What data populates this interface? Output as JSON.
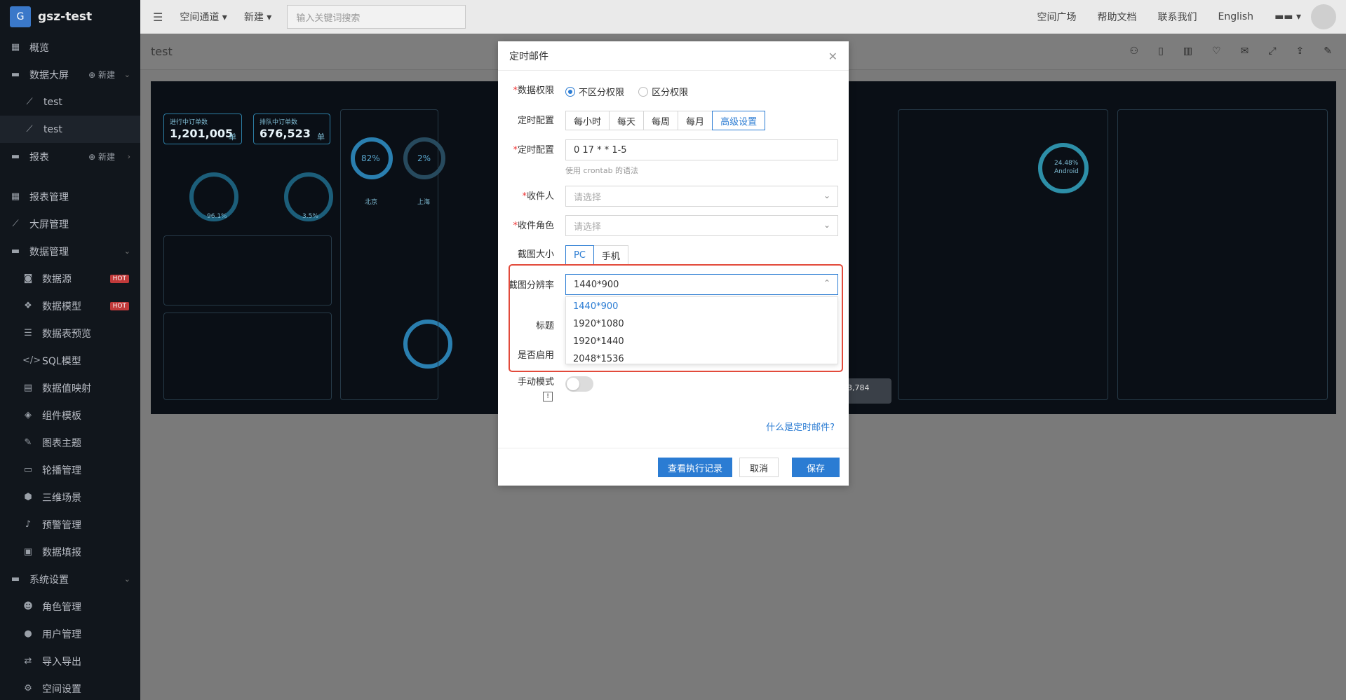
{
  "sidebar": {
    "brand_letter": "G",
    "brand_name": "gsz-test",
    "new_label": "新建",
    "items": [
      {
        "label": "概览"
      },
      {
        "label": "数据大屏"
      },
      {
        "label": "test"
      },
      {
        "label": "test"
      },
      {
        "label": "报表"
      },
      {
        "label": "报表管理"
      },
      {
        "label": "大屏管理"
      },
      {
        "label": "数据管理"
      },
      {
        "label": "数据源"
      },
      {
        "label": "数据模型"
      },
      {
        "label": "数据表预览"
      },
      {
        "label": "SQL模型"
      },
      {
        "label": "数据值映射"
      },
      {
        "label": "组件模板"
      },
      {
        "label": "图表主题"
      },
      {
        "label": "轮播管理"
      },
      {
        "label": "三维场景"
      },
      {
        "label": "预警管理"
      },
      {
        "label": "数据填报"
      },
      {
        "label": "系统设置"
      },
      {
        "label": "角色管理"
      },
      {
        "label": "用户管理"
      },
      {
        "label": "导入导出"
      },
      {
        "label": "空间设置"
      }
    ],
    "hot_label": "HOT"
  },
  "topbar": {
    "space_channel": "空间通道",
    "new": "新建",
    "search_placeholder": "输入关键词搜索",
    "plaza": "空间广场",
    "help": "帮助文档",
    "contact": "联系我们",
    "language": "English"
  },
  "subbar": {
    "title": "test"
  },
  "preview": {
    "card1_label": "进行中订单数",
    "card1_value": "1,201,005",
    "card1_unit": "单",
    "card2_label": "排队中订单数",
    "card2_value": "676,523",
    "card2_unit": "单",
    "gauge1_pct": "82%",
    "gauge2_pct": "2%",
    "city1": "北京",
    "city2": "上海",
    "pct_android": "24.48%",
    "android": "Android",
    "p1": "96.1%",
    "p2": "3.5%",
    "stat_value": "3,784"
  },
  "modal": {
    "title": "定时邮件",
    "data_perm_label": "数据权限",
    "perm_opt1": "不区分权限",
    "perm_opt2": "区分权限",
    "schedule_label": "定时配置",
    "schedule_opts": [
      "每小时",
      "每天",
      "每周",
      "每月",
      "高级设置"
    ],
    "cron_label": "定时配置",
    "cron_value": "0 17 * * 1-5",
    "cron_hint": "使用 crontab 的语法",
    "recipient_label": "收件人",
    "recipient_placeholder": "请选择",
    "role_label": "收件角色",
    "role_placeholder": "请选择",
    "size_label": "截图大小",
    "size_opts": [
      "PC",
      "手机"
    ],
    "resolution_label": "截图分辨率",
    "resolution_value": "1440*900",
    "resolution_options": [
      "1440*900",
      "1920*1080",
      "1920*1440",
      "2048*1536"
    ],
    "title_label": "标题",
    "enabled_label": "是否启用",
    "manual_label": "手动模式",
    "info_mark": "!",
    "help_link": "什么是定时邮件?",
    "btn_history": "查看执行记录",
    "btn_cancel": "取消",
    "btn_save": "保存"
  },
  "colors": {
    "accent": "#2b7cd3",
    "highlight": "#e24a3b",
    "sidebar_bg": "#11161c"
  }
}
